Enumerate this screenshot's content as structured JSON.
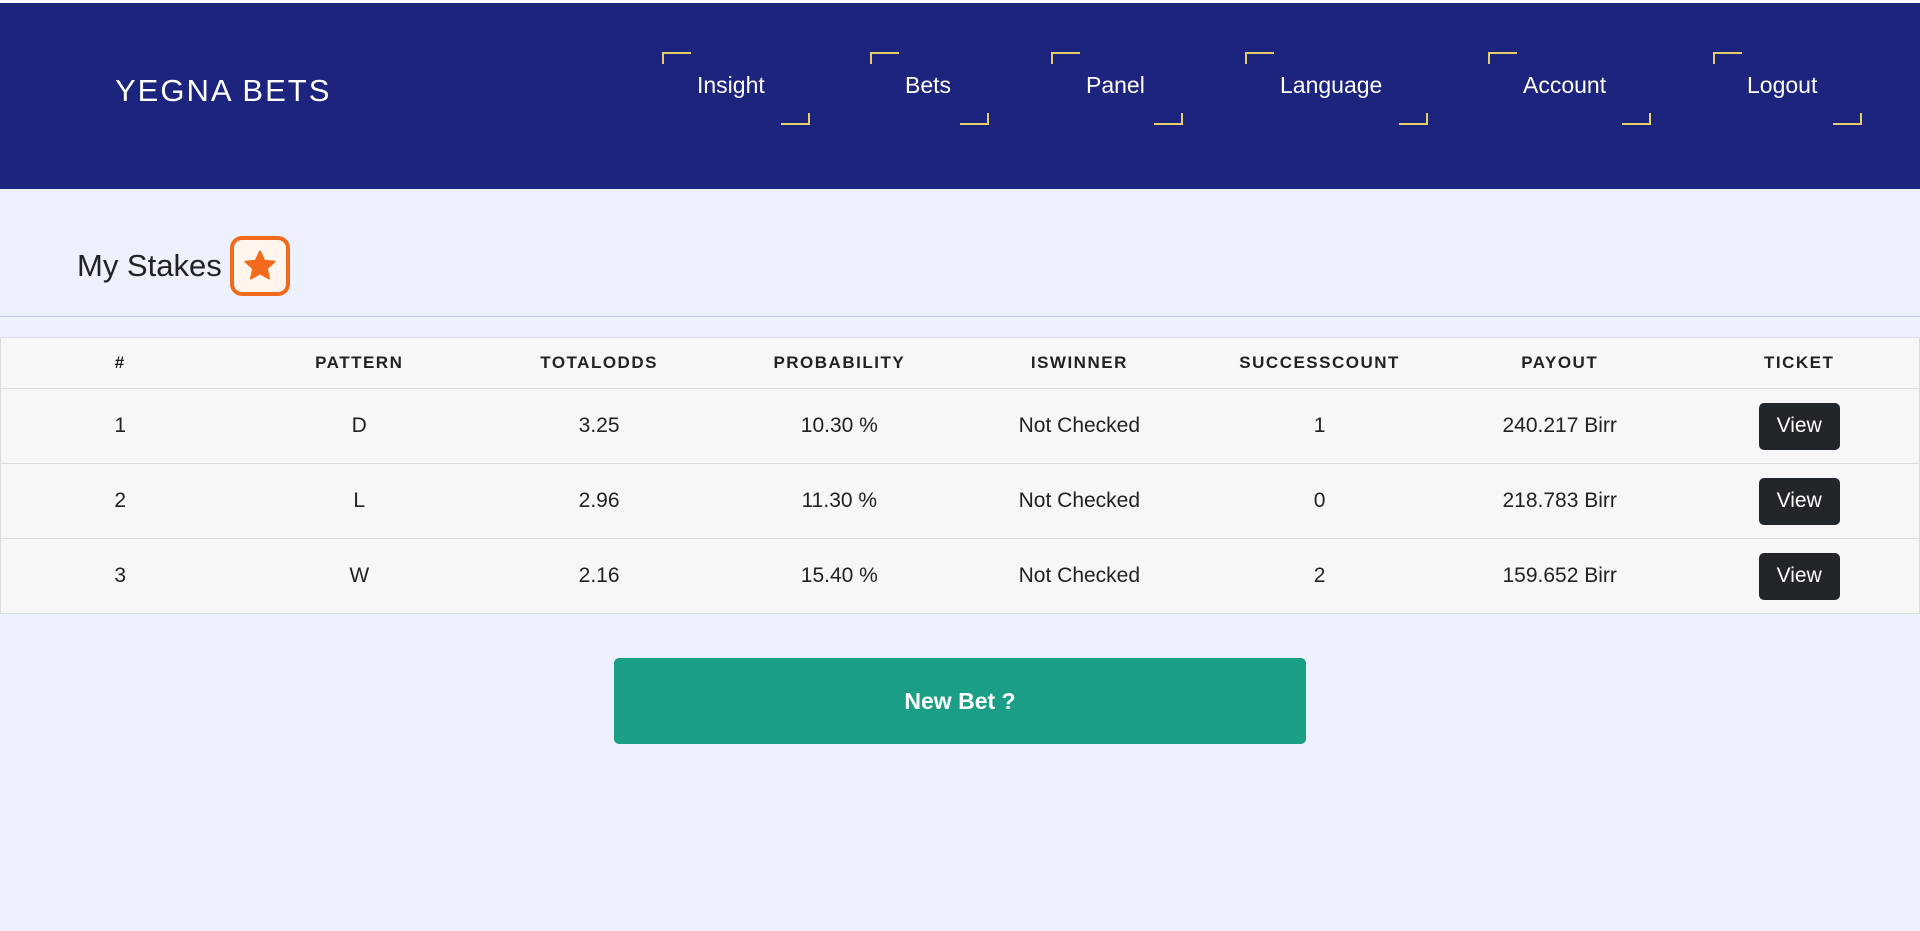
{
  "brand": "YEGNA BETS",
  "nav": {
    "items": [
      {
        "label": "Insight"
      },
      {
        "label": "Bets"
      },
      {
        "label": "Panel"
      },
      {
        "label": "Language"
      },
      {
        "label": "Account"
      },
      {
        "label": "Logout"
      }
    ]
  },
  "section": {
    "title": "My Stakes",
    "icon": "star-icon"
  },
  "table": {
    "headers": [
      "#",
      "PATTERN",
      "TOTALODDS",
      "PROBABILITY",
      "ISWINNER",
      "SUCCESSCOUNT",
      "PAYOUT",
      "TICKET"
    ],
    "rows": [
      {
        "num": "1",
        "pattern": "D",
        "totalodds": "3.25",
        "probability": "10.30 %",
        "iswinner": "Not Checked",
        "successcount": "1",
        "payout": "240.217 Birr",
        "ticket": "View"
      },
      {
        "num": "2",
        "pattern": "L",
        "totalodds": "2.96",
        "probability": "11.30 %",
        "iswinner": "Not Checked",
        "successcount": "0",
        "payout": "218.783 Birr",
        "ticket": "View"
      },
      {
        "num": "3",
        "pattern": "W",
        "totalodds": "2.16",
        "probability": "15.40 %",
        "iswinner": "Not Checked",
        "successcount": "2",
        "payout": "159.652 Birr",
        "ticket": "View"
      }
    ]
  },
  "new_bet_label": "New Bet ?",
  "colors": {
    "navbar": "#1c247d",
    "background": "#edf0fd",
    "accent_corner": "#e6cf6a",
    "star_badge": "#f26a1b",
    "new_bet_button": "#1b9e86",
    "view_button": "#22262b"
  }
}
